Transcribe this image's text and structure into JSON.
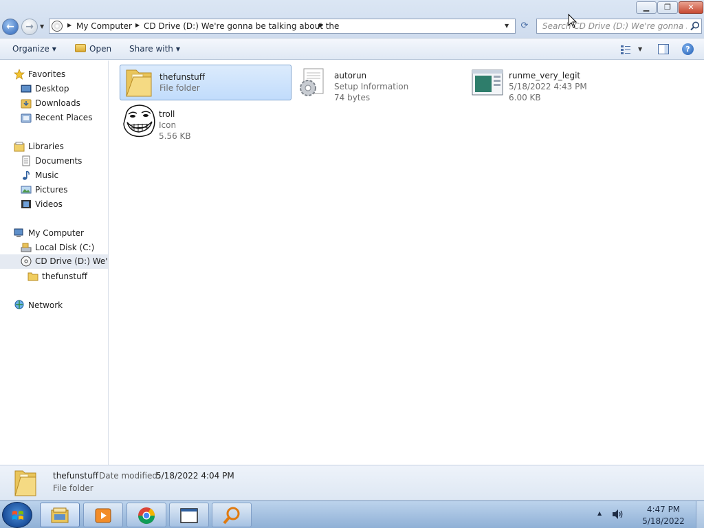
{
  "window": {
    "minimize_glyph": "▁",
    "maximize_glyph": "❐",
    "close_glyph": "✕"
  },
  "address_bar": {
    "breadcrumbs": [
      "My Computer",
      "CD Drive (D:) We're gonna be talking about the"
    ],
    "separator_glyph": "▶"
  },
  "search": {
    "placeholder": "Search CD Drive (D:) We're gonna be ..."
  },
  "command_bar": {
    "organize_label": "Organize",
    "open_label": "Open",
    "share_label": "Share with"
  },
  "nav_pane": {
    "favorites": {
      "label": "Favorites",
      "items": [
        "Desktop",
        "Downloads",
        "Recent Places"
      ]
    },
    "libraries": {
      "label": "Libraries",
      "items": [
        "Documents",
        "Music",
        "Pictures",
        "Videos"
      ]
    },
    "computer": {
      "label": "My Computer",
      "items": [
        "Local Disk (C:)",
        "CD Drive (D:) We're gonna be talking about the"
      ],
      "subfolder": "thefunstuff"
    },
    "network": {
      "label": "Network"
    }
  },
  "files": [
    {
      "name": "thefunstuff",
      "line2": "File folder",
      "line3": "",
      "icon": "folder-icon",
      "selected": true
    },
    {
      "name": "autorun",
      "line2": "Setup Information",
      "line3": "74 bytes",
      "icon": "setup-info-icon",
      "selected": false
    },
    {
      "name": "runme_very_legit",
      "line2": "5/18/2022 4:43 PM",
      "line3": "6.00 KB",
      "icon": "application-icon",
      "selected": false
    },
    {
      "name": "troll",
      "line2": "Icon",
      "line3": "5.56 KB",
      "icon": "troll-face-icon",
      "selected": false
    }
  ],
  "details_pane": {
    "name": "thefunstuff",
    "date_label": "Date modified:",
    "date_value": "5/18/2022 4:04 PM",
    "type": "File folder"
  },
  "taskbar": {
    "apps": [
      {
        "icon": "file-explorer-icon",
        "active": true
      },
      {
        "icon": "media-player-icon",
        "active": false
      },
      {
        "icon": "chrome-icon",
        "active": false
      },
      {
        "icon": "window-app-icon",
        "active": false
      },
      {
        "icon": "search-magnifier-icon",
        "active": false
      }
    ],
    "clock_time": "4:47 PM",
    "clock_date": "5/18/2022"
  },
  "colors": {
    "selection": "#c1dcfc",
    "accent": "#1f5bb2"
  }
}
